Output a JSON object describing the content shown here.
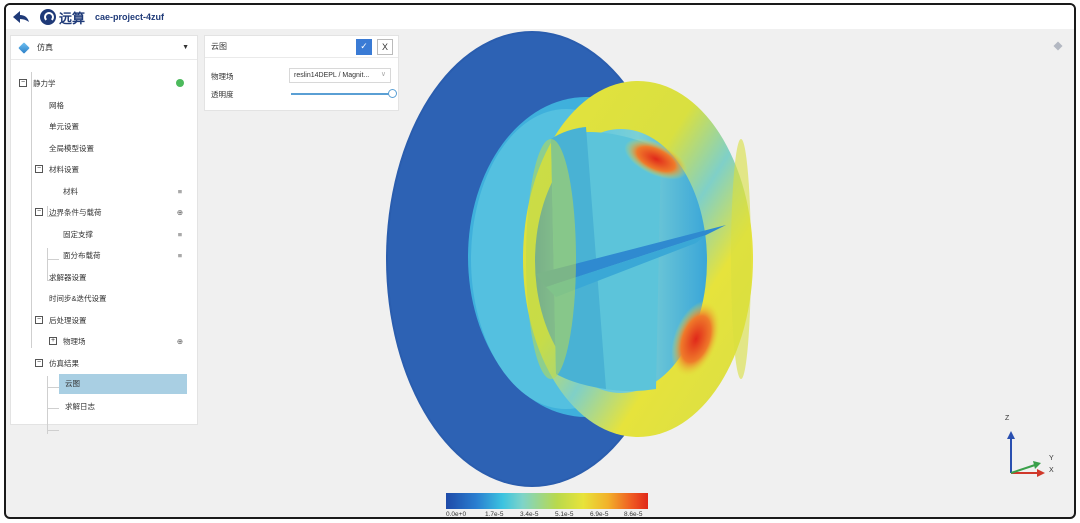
{
  "header": {
    "brand": "远算",
    "project_name": "cae-project-4zuf"
  },
  "sidebar": {
    "module": "仿真",
    "tree": [
      {
        "label": "静力学",
        "level": 0,
        "toggle": "−",
        "status": "complete"
      },
      {
        "label": "网格",
        "level": 1
      },
      {
        "label": "单元设置",
        "level": 1
      },
      {
        "label": "全局模型设置",
        "level": 1
      },
      {
        "label": "材料设置",
        "level": 1,
        "toggle": "−"
      },
      {
        "label": "材料",
        "level": 2,
        "icon": "list-icon"
      },
      {
        "label": "边界条件与载荷",
        "level": 1,
        "toggle": "−",
        "icon": "add-circle-icon"
      },
      {
        "label": "固定支撑",
        "level": 2,
        "icon": "list-icon"
      },
      {
        "label": "面分布载荷",
        "level": 2,
        "icon": "list-icon"
      },
      {
        "label": "求解器设置",
        "level": 1
      },
      {
        "label": "时间步&迭代设置",
        "level": 1
      },
      {
        "label": "后处理设置",
        "level": 1,
        "toggle": "−"
      },
      {
        "label": "物理场",
        "level": 2,
        "toggle": "+",
        "icon": "add-circle-icon"
      },
      {
        "label": "仿真结果",
        "level": 1,
        "toggle": "−"
      },
      {
        "label": "云图",
        "level": 2,
        "selected": true
      },
      {
        "label": "求解日志",
        "level": 2
      }
    ]
  },
  "contour_panel": {
    "title": "云图",
    "ok_label": "✓",
    "close_label": "X",
    "field_label": "物理场",
    "field_value": "reslin14DEPL / Magnit...",
    "opacity_label": "透明度",
    "opacity_value": 1.0
  },
  "colorbar": {
    "labels": [
      "0.0e+0",
      "1.7e-5",
      "3.4e-5",
      "5.1e-5",
      "6.9e-5",
      "8.6e-5"
    ]
  },
  "axes": {
    "z": "Z",
    "y": "Y",
    "x": "X"
  },
  "colors": {
    "accent": "#3a7bd5",
    "selected": "#a9cfe3",
    "status_ok": "#4cba5c",
    "brand": "#1f3a78"
  }
}
